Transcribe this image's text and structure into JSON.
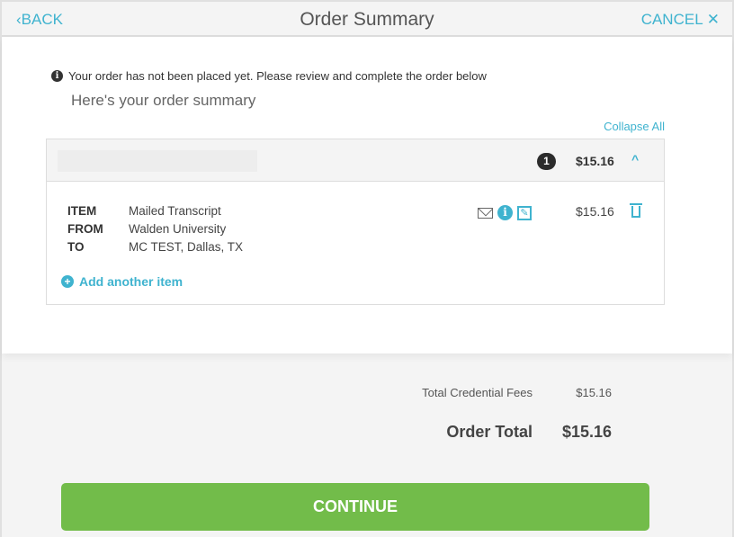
{
  "header": {
    "back_label": "‹BACK",
    "title": "Order Summary",
    "cancel_label": "CANCEL ✕"
  },
  "main": {
    "notice": "Your order has not been placed yet. Please review and complete the order below",
    "subtitle": "Here's your order summary",
    "collapse_all": "Collapse All"
  },
  "order_group": {
    "count": "1",
    "price": "$15.16",
    "chevron": "^",
    "item": {
      "item_label": "ITEM",
      "item_value": "Mailed Transcript",
      "from_label": "FROM",
      "from_value": "Walden University",
      "to_label": "TO",
      "to_value": "MC TEST, Dallas, TX",
      "price": "$15.16"
    },
    "add_another": "Add another item"
  },
  "totals": {
    "fees_label": "Total Credential Fees",
    "fees_value": "$15.16",
    "order_total_label": "Order Total",
    "order_total_value": "$15.16"
  },
  "continue_label": "CONTINUE",
  "colors": {
    "accent": "#3fb3cf",
    "continue": "#72bc4a"
  }
}
